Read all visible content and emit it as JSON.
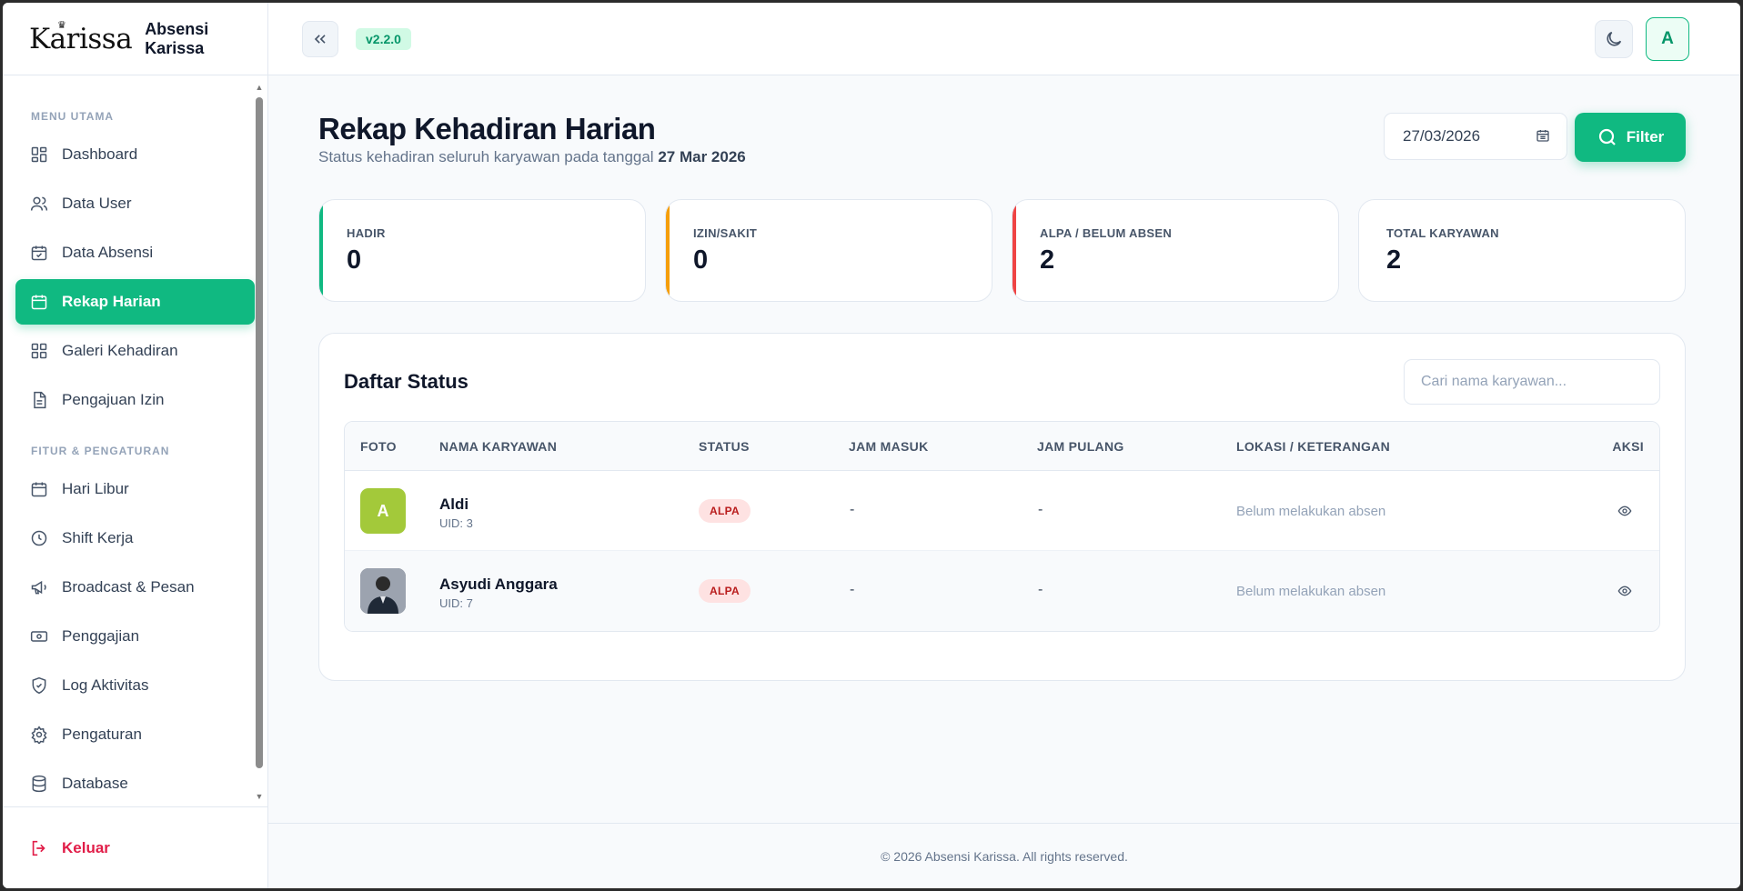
{
  "app": {
    "logo_text": "Karissa",
    "name": "Absensi Karissa",
    "version": "v2.2.0",
    "user_initial": "A"
  },
  "sidebar": {
    "section_main": "MENU UTAMA",
    "main_items": [
      {
        "label": "Dashboard",
        "icon": "grid-icon"
      },
      {
        "label": "Data User",
        "icon": "users-icon"
      },
      {
        "label": "Data Absensi",
        "icon": "calendar-check-icon"
      },
      {
        "label": "Rekap Harian",
        "icon": "calendar-icon",
        "active": true
      },
      {
        "label": "Galeri Kehadiran",
        "icon": "grid-icon"
      },
      {
        "label": "Pengajuan Izin",
        "icon": "document-icon"
      }
    ],
    "section_settings": "FITUR & PENGATURAN",
    "settings_items": [
      {
        "label": "Hari Libur",
        "icon": "calendar-icon"
      },
      {
        "label": "Shift Kerja",
        "icon": "clock-icon"
      },
      {
        "label": "Broadcast & Pesan",
        "icon": "megaphone-icon"
      },
      {
        "label": "Penggajian",
        "icon": "banknote-icon"
      },
      {
        "label": "Log Aktivitas",
        "icon": "shield-icon"
      },
      {
        "label": "Pengaturan",
        "icon": "gear-icon"
      },
      {
        "label": "Database",
        "icon": "database-icon"
      }
    ],
    "logout_label": "Keluar"
  },
  "header": {
    "title": "Rekap Kehadiran Harian",
    "subtitle_prefix": "Status kehadiran seluruh karyawan pada tanggal",
    "subtitle_date": "27 Mar 2026",
    "date_value": "27/03/2026",
    "filter_label": "Filter"
  },
  "stats": [
    {
      "label": "HADIR",
      "value": "0",
      "accent": "#10b981"
    },
    {
      "label": "IZIN/SAKIT",
      "value": "0",
      "accent": "#f59e0b"
    },
    {
      "label": "ALPA / BELUM ABSEN",
      "value": "2",
      "accent": "#ef4444"
    },
    {
      "label": "TOTAL KARYAWAN",
      "value": "2",
      "accent": "#ffffff"
    }
  ],
  "list": {
    "title": "Daftar Status",
    "search_placeholder": "Cari nama karyawan...",
    "columns": [
      "FOTO",
      "NAMA KARYAWAN",
      "STATUS",
      "JAM MASUK",
      "JAM PULANG",
      "LOKASI / KETERANGAN",
      "AKSI"
    ],
    "rows": [
      {
        "initial": "A",
        "name": "Aldi",
        "uid": "UID: 3",
        "status": "ALPA",
        "jam_masuk": "-",
        "jam_pulang": "-",
        "keterangan": "Belum melakukan absen"
      },
      {
        "initial": "",
        "name": "Asyudi Anggara",
        "uid": "UID: 7",
        "status": "ALPA",
        "jam_masuk": "-",
        "jam_pulang": "-",
        "keterangan": "Belum melakukan absen"
      }
    ]
  },
  "footer": {
    "text": "© 2026 Absensi Karissa. All rights reserved."
  },
  "colors": {
    "accent": "#10b981",
    "danger": "#e11d48"
  }
}
